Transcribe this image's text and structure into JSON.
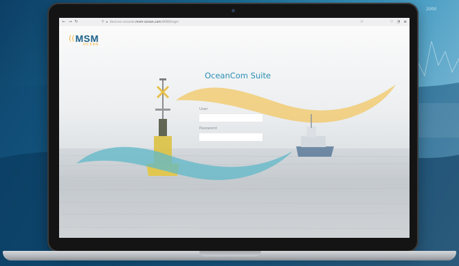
{
  "window": {
    "url_prefix": "devices-console.",
    "url_host": "msm-ocean.com",
    "url_suffix": ":8080/login"
  },
  "brand": {
    "logo_main": "MSM",
    "logo_sub": "OCEAN"
  },
  "login": {
    "title": "OceanCom Suite",
    "user_label": "User",
    "user_value": "",
    "password_label": "Password",
    "password_value": ""
  },
  "background": {
    "chart_label": "2000"
  },
  "colors": {
    "accent_blue": "#2b8fb8",
    "accent_yellow": "#f2b336",
    "wave_teal": "#5fb8c8"
  }
}
